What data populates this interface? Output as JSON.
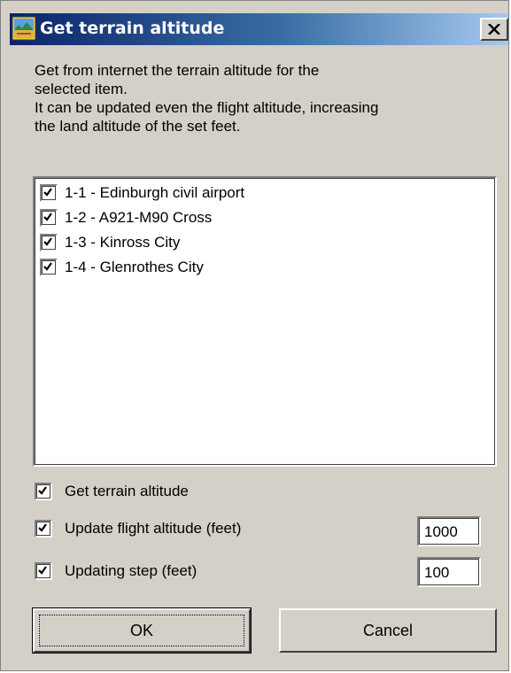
{
  "window": {
    "title": "Get terrain altitude",
    "close_glyph": "X"
  },
  "description": {
    "lines": [
      "Get from internet the terrain altitude for the",
      "selected item.",
      "It can be updated even the flight altitude, increasing",
      "the land altitude of the set feet."
    ]
  },
  "list": {
    "items": [
      {
        "label": "1-1 - Edinburgh civil airport",
        "checked": true
      },
      {
        "label": "1-2 - A921-M90 Cross",
        "checked": true
      },
      {
        "label": "1-3 - Kinross City",
        "checked": true
      },
      {
        "label": "1-4 - Glenrothes City",
        "checked": true
      }
    ]
  },
  "options": {
    "get_terrain": {
      "label": "Get terrain altitude",
      "checked": true
    },
    "update_flight": {
      "label": "Update flight altitude (feet)",
      "checked": true,
      "value": "1000"
    },
    "updating_step": {
      "label": "Updating step (feet)",
      "checked": true,
      "value": "100"
    }
  },
  "buttons": {
    "ok_label": "OK",
    "cancel_label": "Cancel"
  },
  "colors": {
    "titlebar_start": "#0a246a",
    "titlebar_end": "#a6caf0",
    "dialog_face": "#d4d0c8"
  },
  "icons": {
    "window": "terrain-map-icon",
    "close": "close-icon",
    "check": "checkmark-icon"
  }
}
